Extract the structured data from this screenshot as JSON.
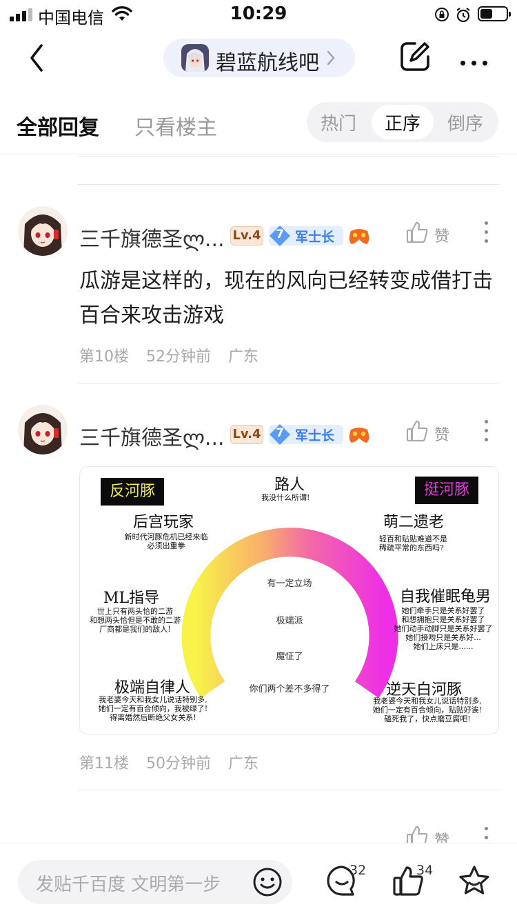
{
  "status": {
    "carrier": "中国电信",
    "time": "10:29"
  },
  "nav": {
    "forum_name": "碧蓝航线吧"
  },
  "tabs": {
    "all": "全部回复",
    "owner_only": "只看楼主",
    "sort": [
      "热门",
      "正序",
      "倒序"
    ],
    "active_sort": "正序"
  },
  "posts": [
    {
      "username": "三千旗德圣ლ...",
      "level": "Lv.4",
      "rank_num": "7",
      "rank_title": "军士长",
      "like_label": "赞",
      "content": "瓜游是这样的，现在的风向已经转变成借打击百合来攻击游戏",
      "floor": "第10楼",
      "time": "52分钟前",
      "location": "广东"
    },
    {
      "username": "三千旗德圣ლ...",
      "level": "Lv.4",
      "rank_num": "7",
      "rank_title": "军士长",
      "like_label": "赞",
      "floor": "第11楼",
      "time": "50分钟前",
      "location": "广东",
      "image": {
        "left_tag": "反河豚",
        "right_tag": "挺河豚",
        "top_title": "路人",
        "top_sub": "我没什么所谓!",
        "l1_title": "后宫玩家",
        "l1_sub": [
          "新时代河豚危机已经来临",
          "必须出重拳"
        ],
        "l2_title": "ML指导",
        "l2_sub": [
          "世上只有两头恰的二游",
          "和想两头恰但是不敢的二游",
          "厂商都是我们的敌人!"
        ],
        "l3_title": "极端自律人",
        "l3_sub": [
          "我老婆今天和我女儿说话特别多,",
          "她们一定有百合倾向，我被绿了!",
          "得离婚然后断绝父女关系!"
        ],
        "r1_title": "萌二遗老",
        "r1_sub": [
          "轻百和贴贴难道不是",
          "稀疏平常的东西吗?"
        ],
        "r2_title": "自我催眠龟男",
        "r2_sub": [
          "她们牵手只是关系好罢了",
          "和想拥抱只是关系好罢了",
          "她们动手动脚只是关系好罢了",
          "她们接吻只是关系好...",
          "她们上床只是......"
        ],
        "r3_title": "逆天白河豚",
        "r3_sub": [
          "我老婆今天和我女儿说话特别多,",
          "她们一定有百合倾向，贴贴好诶!",
          "磕死我了，快点磨豆腐吧!"
        ],
        "center": [
          "有一定立场",
          "极端派",
          "魔怔了",
          "你们两个差不多得了"
        ]
      }
    }
  ],
  "partial_post": {
    "like_label": "赞"
  },
  "bottom": {
    "input_placeholder": "发贴千百度 文明第一步",
    "comment_count": "32",
    "like_count": "34"
  },
  "colors": {
    "tag_left_text": "#f2e94a",
    "tag_right_text": "#e23ad9",
    "rank_blue": "#3b7df0",
    "arc_start": "#f8f24a",
    "arc_end": "#ee2fe6"
  }
}
